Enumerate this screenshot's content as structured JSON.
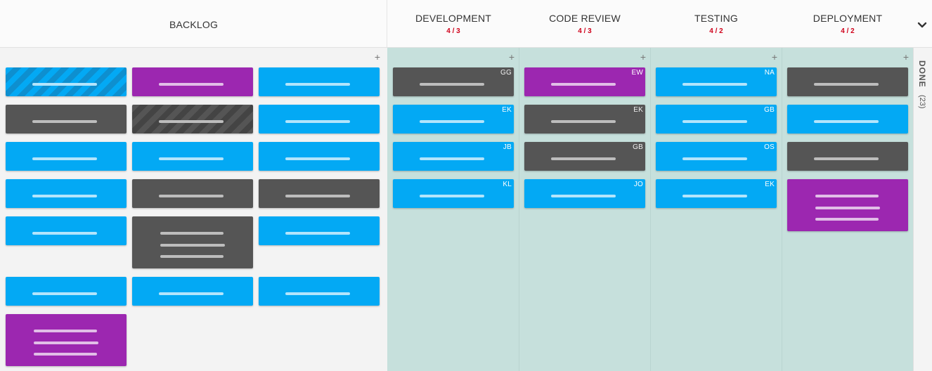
{
  "columns": [
    {
      "title": "BACKLOG",
      "wip": ""
    },
    {
      "title": "DEVELOPMENT",
      "wip": "4 / 3"
    },
    {
      "title": "CODE REVIEW",
      "wip": "4 / 3"
    },
    {
      "title": "TESTING",
      "wip": "4 / 2"
    },
    {
      "title": "DEPLOYMENT",
      "wip": "4 / 2"
    }
  ],
  "done": {
    "label": "DONE",
    "count": "(23)"
  },
  "add_symbol": "+",
  "colors": {
    "blue": "#03a9f4",
    "gray": "#555555",
    "purple": "#9c27b0",
    "wip_limit": "#d0021b",
    "lane_bg": "#c6e0dc"
  },
  "icons": {
    "collapse": "chevron-down-icon",
    "add": "plus-icon"
  },
  "backlog_cards": [
    {
      "color": "blue",
      "striped": true,
      "lines": 1
    },
    {
      "color": "purple",
      "striped": false,
      "lines": 1
    },
    {
      "color": "blue",
      "striped": false,
      "lines": 1
    },
    {
      "color": "gray",
      "striped": false,
      "lines": 1
    },
    {
      "color": "gray",
      "striped": true,
      "lines": 1
    },
    {
      "color": "blue",
      "striped": false,
      "lines": 1
    },
    {
      "color": "blue",
      "striped": false,
      "lines": 1
    },
    {
      "color": "blue",
      "striped": false,
      "lines": 1
    },
    {
      "color": "blue",
      "striped": false,
      "lines": 1
    },
    {
      "color": "blue",
      "striped": false,
      "lines": 1
    },
    {
      "color": "gray",
      "striped": false,
      "lines": 1
    },
    {
      "color": "gray",
      "striped": false,
      "lines": 1
    },
    {
      "color": "blue",
      "striped": false,
      "lines": 1
    },
    {
      "color": "gray",
      "striped": false,
      "lines": 3
    },
    {
      "color": "blue",
      "striped": false,
      "lines": 1
    },
    {
      "color": "blue",
      "striped": false,
      "lines": 1
    },
    {
      "color": "blue",
      "striped": false,
      "lines": 1
    },
    {
      "color": "blue",
      "striped": false,
      "lines": 1
    },
    {
      "color": "purple",
      "striped": false,
      "lines": 3
    }
  ],
  "lanes": [
    {
      "cards": [
        {
          "color": "gray",
          "initials": "GG",
          "lines": 1
        },
        {
          "color": "blue",
          "initials": "EK",
          "lines": 1
        },
        {
          "color": "blue",
          "initials": "JB",
          "lines": 1
        },
        {
          "color": "blue",
          "initials": "KL",
          "lines": 1
        }
      ]
    },
    {
      "cards": [
        {
          "color": "purple",
          "initials": "EW",
          "lines": 1
        },
        {
          "color": "gray",
          "initials": "EK",
          "lines": 1
        },
        {
          "color": "gray",
          "initials": "GB",
          "lines": 1
        },
        {
          "color": "blue",
          "initials": "JO",
          "lines": 1
        }
      ]
    },
    {
      "cards": [
        {
          "color": "blue",
          "initials": "NA",
          "lines": 1
        },
        {
          "color": "blue",
          "initials": "GB",
          "lines": 1
        },
        {
          "color": "blue",
          "initials": "OS",
          "lines": 1
        },
        {
          "color": "blue",
          "initials": "EK",
          "lines": 1
        }
      ]
    },
    {
      "cards": [
        {
          "color": "gray",
          "initials": "",
          "lines": 1
        },
        {
          "color": "blue",
          "initials": "",
          "lines": 1
        },
        {
          "color": "gray",
          "initials": "",
          "lines": 1
        },
        {
          "color": "purple",
          "initials": "",
          "lines": 3
        }
      ]
    }
  ]
}
